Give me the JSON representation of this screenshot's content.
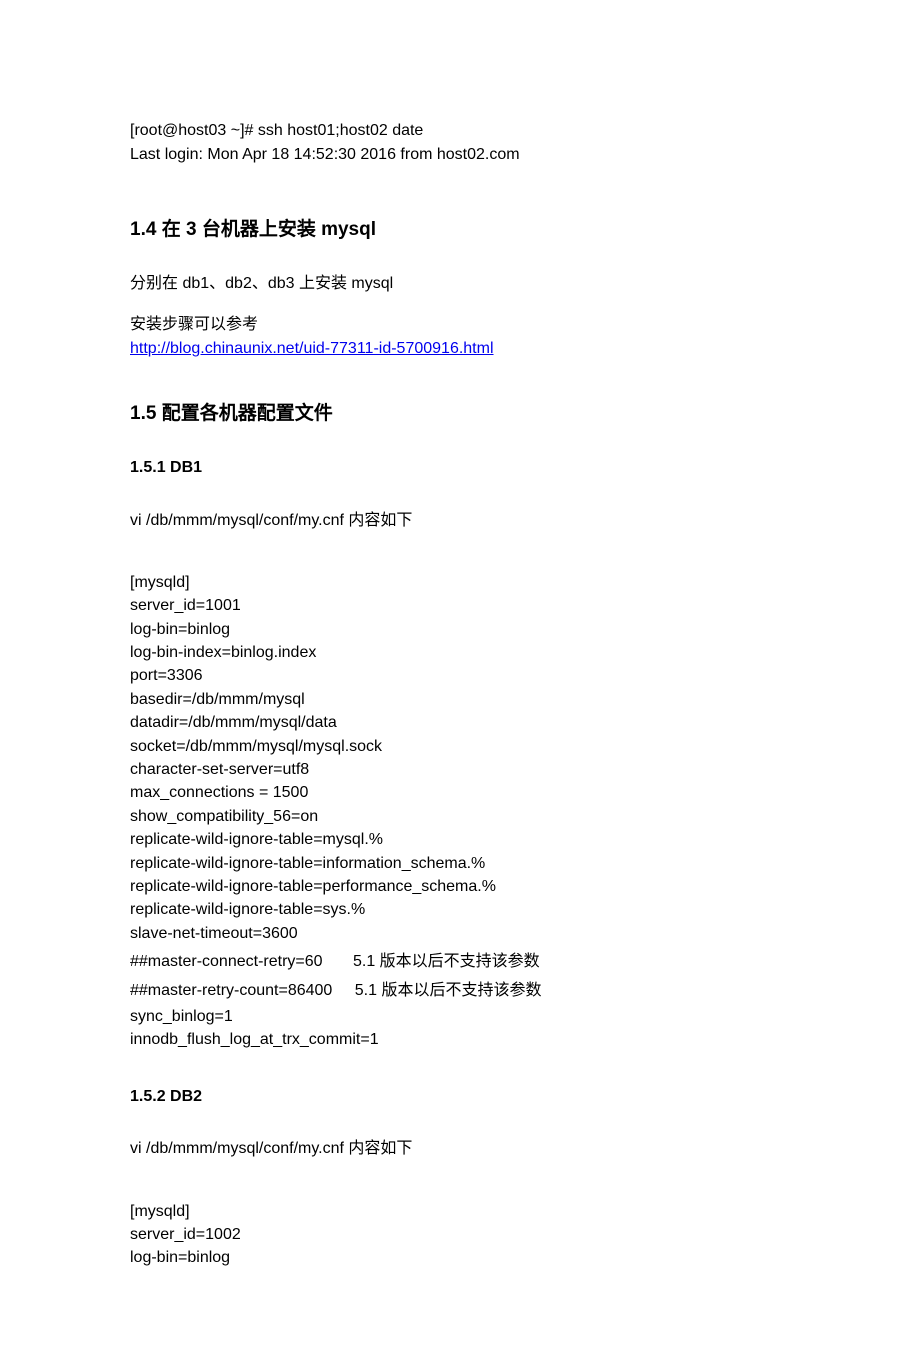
{
  "top_code": {
    "line1": "[root@host03 ~]# ssh host01;host02 date",
    "line2": "Last login: Mon Apr 18 14:52:30 2016 from host02.com"
  },
  "sec14": {
    "heading": "1.4 在 3 台机器上安装 mysql",
    "p1": "分别在 db1、db2、db3 上安装 mysql",
    "p2": "安装步骤可以参考",
    "link": "http://blog.chinaunix.net/uid-77311-id-5700916.html"
  },
  "sec15": {
    "heading": "1.5 配置各机器配置文件"
  },
  "sec151": {
    "heading": "1.5.1    DB1",
    "intro": "vi    /db/mmm/mysql/conf/my.cnf  内容如下",
    "lines": {
      "l1": "[mysqld]",
      "l2": "server_id=1001",
      "l3": "log-bin=binlog",
      "l4": "log-bin-index=binlog.index",
      "l5": "port=3306",
      "l6": "basedir=/db/mmm/mysql",
      "l7": "datadir=/db/mmm/mysql/data",
      "l8": "socket=/db/mmm/mysql/mysql.sock",
      "l9": "character-set-server=utf8",
      "l10": "max_connections = 1500",
      "l11": "show_compatibility_56=on",
      "l12": "replicate-wild-ignore-table=mysql.%",
      "l13": "replicate-wild-ignore-table=information_schema.%",
      "l14": "replicate-wild-ignore-table=performance_schema.%",
      "l15": "replicate-wild-ignore-table=sys.%",
      "l16": "slave-net-timeout=3600",
      "l17a": "##master-connect-retry=60",
      "l17b": "5.1 版本以后不支持该参数",
      "l18a": "##master-retry-count=86400",
      "l18b": "5.1 版本以后不支持该参数",
      "l19": "sync_binlog=1",
      "l20": "innodb_flush_log_at_trx_commit=1"
    }
  },
  "sec152": {
    "heading": "1.5.2    DB2",
    "intro": "vi    /db/mmm/mysql/conf/my.cnf  内容如下",
    "lines": {
      "l1": "[mysqld]",
      "l2": "server_id=1002",
      "l3": "log-bin=binlog"
    }
  }
}
